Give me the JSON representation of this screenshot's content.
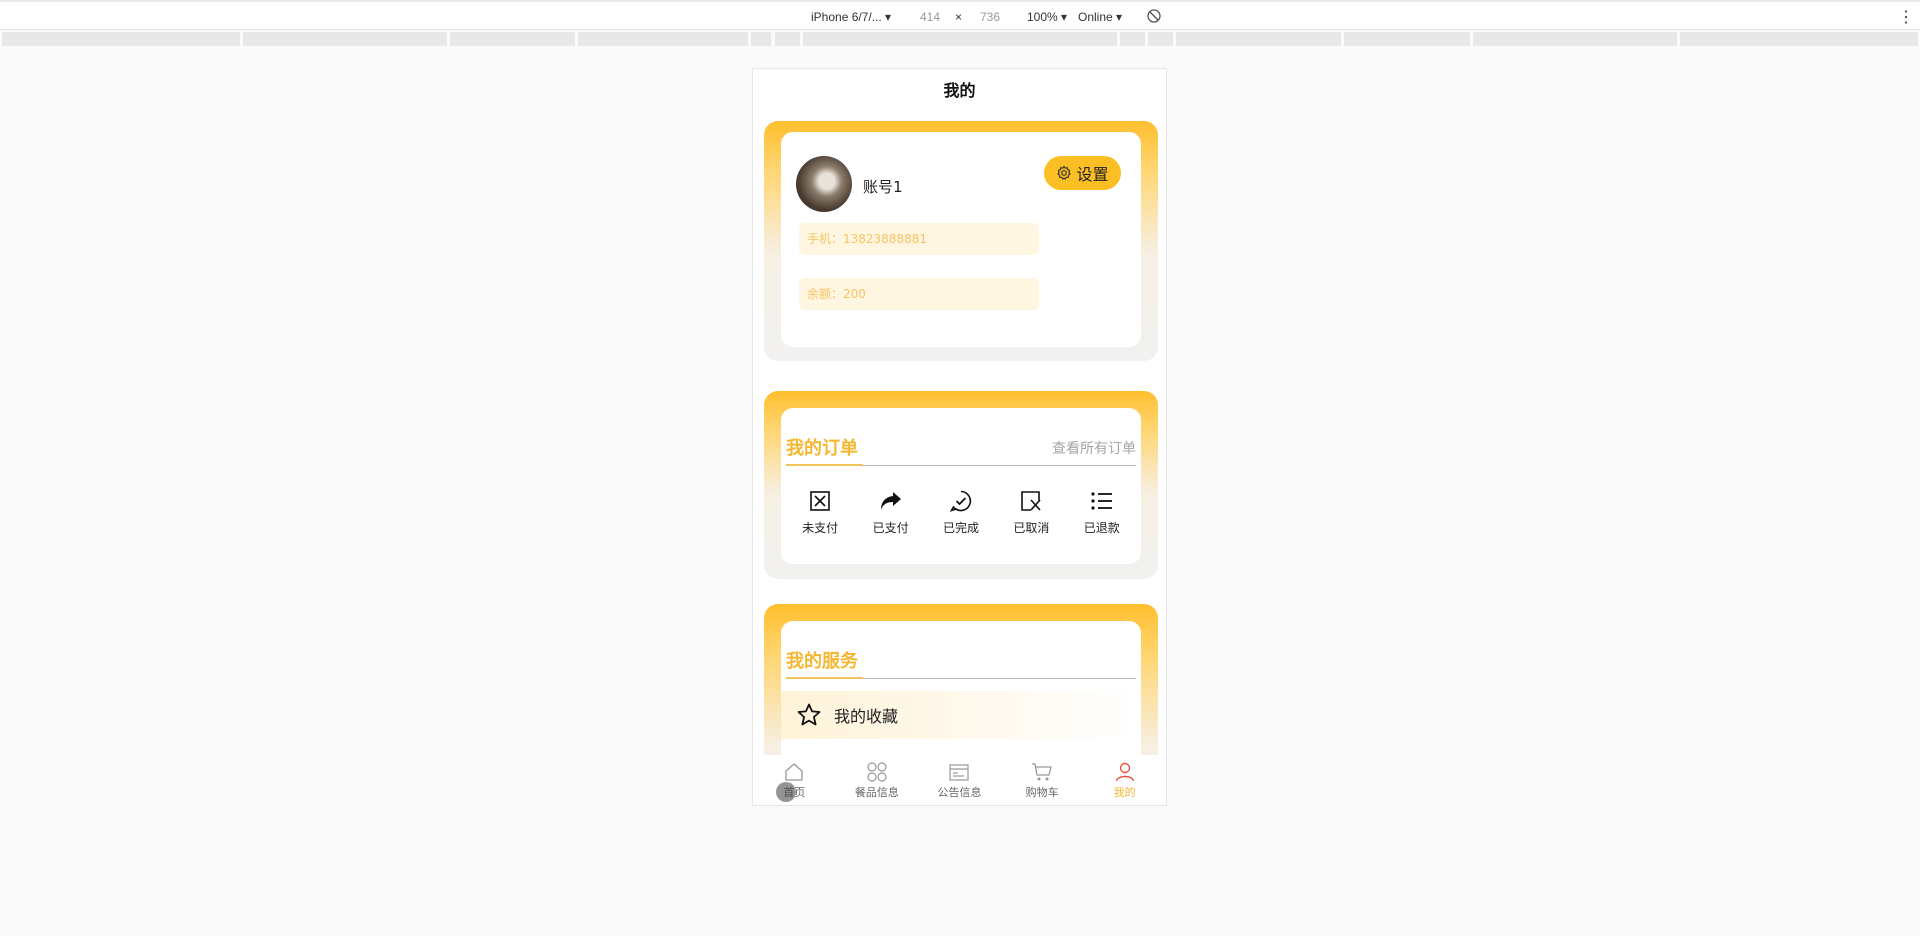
{
  "devtools": {
    "device": "iPhone 6/7/...",
    "width": "414",
    "times": "×",
    "height": "736",
    "zoom": "100%",
    "network": "Online",
    "more": "⋮"
  },
  "page": {
    "title": "我的"
  },
  "profile": {
    "account_name": "账号1",
    "settings_label": "设置",
    "phone_text": "手机：13823888881",
    "balance_text": "余额：200"
  },
  "orders": {
    "title": "我的订单",
    "view_all": "查看所有订单",
    "items": [
      {
        "label": "未支付",
        "icon": "unpaid-icon"
      },
      {
        "label": "已支付",
        "icon": "paid-icon"
      },
      {
        "label": "已完成",
        "icon": "completed-icon"
      },
      {
        "label": "已取消",
        "icon": "cancelled-icon"
      },
      {
        "label": "已退款",
        "icon": "refunded-icon"
      }
    ]
  },
  "services": {
    "title": "我的服务",
    "items": [
      {
        "label": "我的收藏",
        "icon": "star-icon"
      }
    ]
  },
  "tabbar": {
    "items": [
      {
        "label": "首页",
        "icon": "home-icon"
      },
      {
        "label": "餐品信息",
        "icon": "grid-icon"
      },
      {
        "label": "公告信息",
        "icon": "notice-icon"
      },
      {
        "label": "购物车",
        "icon": "cart-icon"
      },
      {
        "label": "我的",
        "icon": "user-icon",
        "active": true
      }
    ]
  },
  "colors": {
    "accent": "#fbbf24",
    "accent_text": "#f5b731",
    "pill_bg": "#fff6e2"
  }
}
